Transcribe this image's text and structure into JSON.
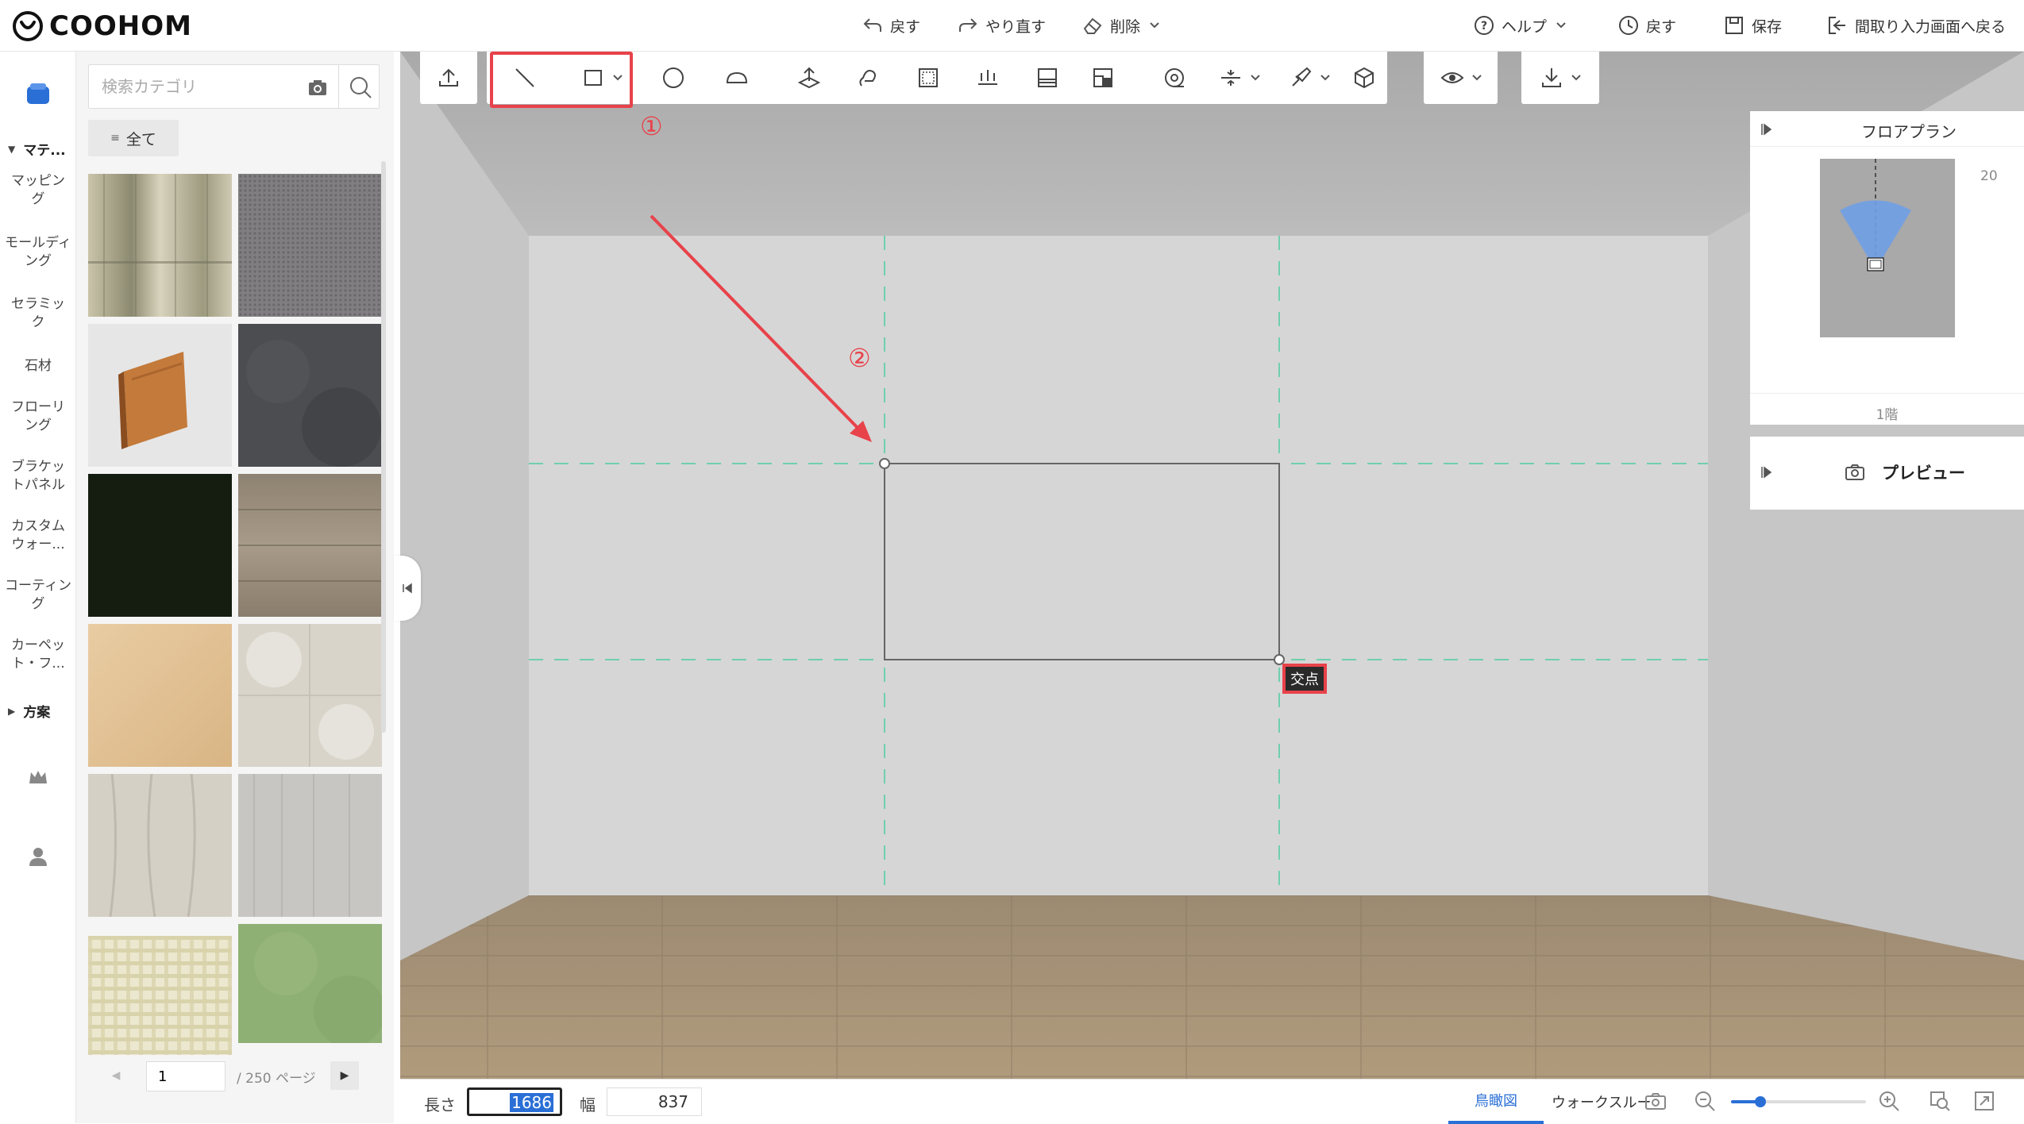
{
  "brand": {
    "name": "COOHOM"
  },
  "topbar": {
    "undo": "戻す",
    "redo": "やり直す",
    "delete": "削除",
    "help": "ヘルプ",
    "history": "戻す",
    "save": "保存",
    "back_to_floorplan": "間取り入力画面へ戻る"
  },
  "rail": {
    "section_material": "マテ...",
    "items": [
      "マッピング",
      "モールディング",
      "セラミック",
      "石材",
      "フローリング",
      "ブラケットパネル",
      "カスタムウォー...",
      "コーティング",
      "カーペット・フ..."
    ],
    "section_plan": "方案"
  },
  "catalog": {
    "search_placeholder": "検索カテゴリ",
    "filter_all": "全て",
    "page_current": "1",
    "page_total": "/ 250 ページ"
  },
  "toolbar": {
    "icons": [
      "upload-icon",
      "line-tool-icon",
      "rectangle-tool-icon",
      "circle-tool-icon",
      "arc-tool-icon",
      "extrude-icon",
      "push-pull-icon",
      "frame-icon",
      "spacing-icon",
      "panel-icon",
      "split-icon",
      "measure-icon",
      "align-icon",
      "brush-icon",
      "cube-icon",
      "eye-icon",
      "download-icon"
    ]
  },
  "annotations": {
    "step1": "①",
    "step2": "②",
    "intersection": "交点"
  },
  "floorplan_panel": {
    "title": "フロアプラン",
    "zoom": "20",
    "floor": "1階"
  },
  "preview_panel": {
    "label": "プレビュー"
  },
  "bottombar": {
    "length_label": "長さ",
    "length_value": "1686",
    "width_label": "幅",
    "width_value": "837",
    "tab_birdseye": "鳥瞰図",
    "tab_walkthrough": "ウォークスルー",
    "zoom_level": 0.22
  },
  "colors": {
    "accent": "#2a6fd6",
    "highlight": "#e8424a",
    "guide": "#6fcfae"
  }
}
